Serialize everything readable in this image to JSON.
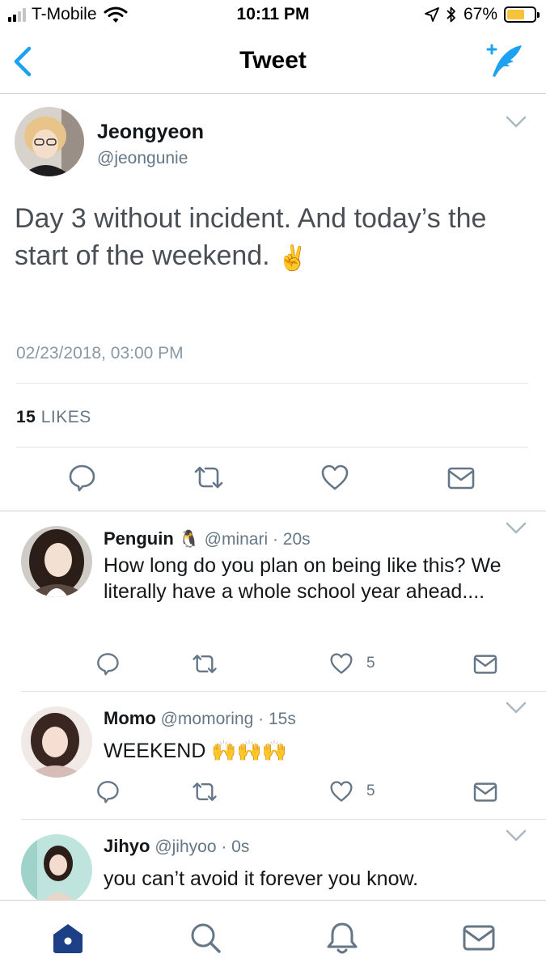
{
  "status_bar": {
    "carrier": "T-Mobile",
    "time": "10:11 PM",
    "battery": "67%",
    "battery_level": 0.67,
    "battery_color": "#f7c33a"
  },
  "nav": {
    "title": "Tweet",
    "back_icon": "back-chevron-icon",
    "compose_icon": "compose-tweet-icon"
  },
  "main_tweet": {
    "name": "Jeongyeon",
    "handle": "@jeongunie",
    "text": "Day 3 without incident. And today’s the start of the weekend.",
    "emoji": "✌️",
    "timestamp": "02/23/2018, 03:00 PM",
    "likes_count": "15",
    "likes_label": "LIKES"
  },
  "replies": [
    {
      "name": "Penguin",
      "name_emoji": "🐧",
      "handle": "@minari",
      "time": "· 20s",
      "text": "How long do you plan on being like this? We literally have a whole school year ahead....",
      "likes": "5"
    },
    {
      "name": "Momo",
      "handle": "@momoring",
      "time": "· 15s",
      "text": "WEEKEND",
      "emoji": "🙌🙌🙌",
      "likes": "5"
    },
    {
      "name": "Jihyo",
      "handle": "@jihyoo",
      "time": "· 0s",
      "text": "you can’t avoid it forever you know."
    }
  ],
  "tab_bar": [
    "home-icon",
    "search-icon",
    "notifications-bell-icon",
    "messages-envelope-icon"
  ],
  "colors": {
    "accent": "#1da1f2",
    "secondary_text": "#657786",
    "icon_gray": "#657786",
    "home_active": "#1c3f86"
  }
}
